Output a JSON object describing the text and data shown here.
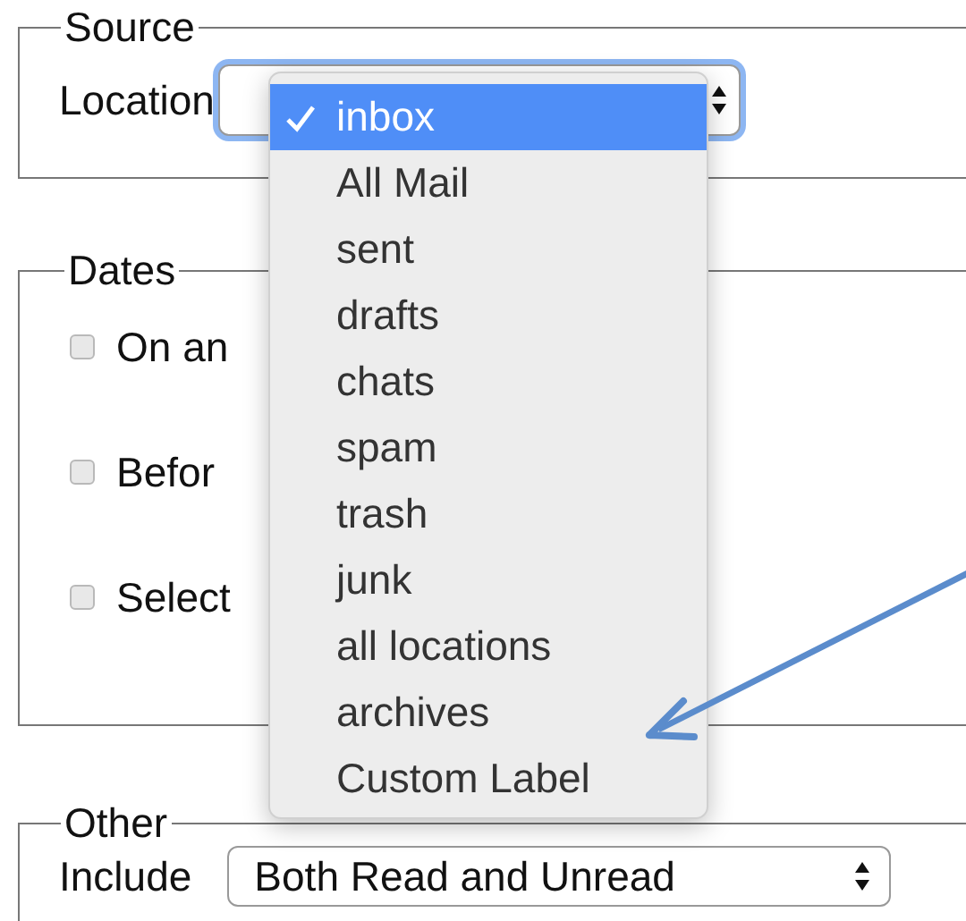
{
  "source": {
    "legend": "Source",
    "location": {
      "label": "Location",
      "menu": {
        "options": [
          {
            "label": "inbox",
            "selected": true
          },
          {
            "label": "All Mail",
            "selected": false
          },
          {
            "label": "sent",
            "selected": false
          },
          {
            "label": "drafts",
            "selected": false
          },
          {
            "label": "chats",
            "selected": false
          },
          {
            "label": "spam",
            "selected": false
          },
          {
            "label": "trash",
            "selected": false
          },
          {
            "label": "junk",
            "selected": false
          },
          {
            "label": "all locations",
            "selected": false
          },
          {
            "label": "archives",
            "selected": false
          },
          {
            "label": "Custom Label",
            "selected": false
          }
        ]
      }
    }
  },
  "dates": {
    "legend": "Dates",
    "options": [
      {
        "label": "On an",
        "checked": false
      },
      {
        "label": "Befor",
        "checked": false
      },
      {
        "label": "Select",
        "checked": false
      }
    ]
  },
  "other": {
    "legend": "Other",
    "include": {
      "label": "Include",
      "value": "Both Read and Unread"
    }
  }
}
